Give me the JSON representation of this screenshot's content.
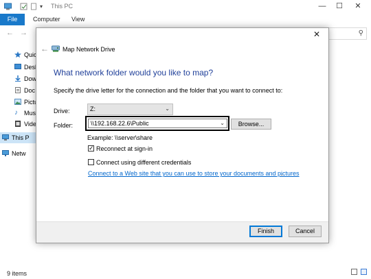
{
  "window": {
    "title": "This PC",
    "controls": {
      "minimize": "—",
      "maximize": "☐",
      "close": "✕"
    }
  },
  "ribbon": {
    "file_tab": "File",
    "tabs": [
      "Computer",
      "View"
    ]
  },
  "address": {
    "back": "←",
    "forward": "→"
  },
  "sidebar": {
    "items": [
      {
        "label": "Quick",
        "icon": "star-icon"
      },
      {
        "label": "Desk",
        "icon": "desktop-icon"
      },
      {
        "label": "Dow",
        "icon": "downloads-icon"
      },
      {
        "label": "Doc",
        "icon": "documents-icon"
      },
      {
        "label": "Pictu",
        "icon": "pictures-icon"
      },
      {
        "label": "Mus",
        "icon": "music-icon"
      },
      {
        "label": "Vide",
        "icon": "videos-icon"
      },
      {
        "label": "This P",
        "icon": "computer-icon"
      },
      {
        "label": "Netw",
        "icon": "network-icon"
      }
    ]
  },
  "status": {
    "items_count": "9 items"
  },
  "dialog": {
    "title": "Map Network Drive",
    "heading": "What network folder would you like to map?",
    "description": "Specify the drive letter for the connection and the folder that you want to connect to:",
    "drive_label": "Drive:",
    "drive_value": "Z:",
    "folder_label": "Folder:",
    "folder_value": "\\\\192.168.22.6\\Public",
    "browse_label": "Browse...",
    "example": "Example: \\\\server\\share",
    "reconnect": {
      "label": "Reconnect at sign-in",
      "checked": true
    },
    "different_credentials": {
      "label": "Connect using different credentials",
      "checked": false
    },
    "link": "Connect to a Web site that you can use to store your documents and pictures",
    "link_suffix": ".",
    "finish_label": "Finish",
    "cancel_label": "Cancel"
  },
  "colors": {
    "accent": "#1979ca",
    "heading": "#1f3f99",
    "link": "#0066cc",
    "selection": "#cce4f7"
  }
}
